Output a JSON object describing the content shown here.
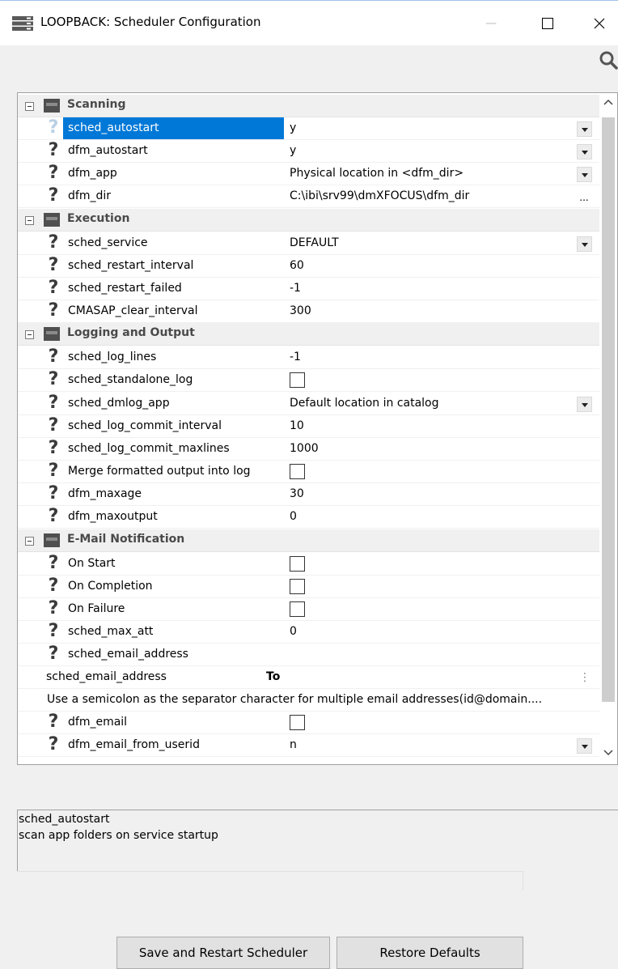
{
  "window": {
    "title": "LOOPBACK: Scheduler Configuration",
    "minimize_glyph": "—",
    "maximize_glyph": "☐",
    "close_glyph": "✕"
  },
  "grid": {
    "categories": {
      "scanning": "Scanning",
      "execution": "Execution",
      "logging": "Logging and Output",
      "email": "E-Mail Notification"
    },
    "properties": {
      "sched_autostart": {
        "name": "sched_autostart",
        "value": "y"
      },
      "dfm_autostart": {
        "name": "dfm_autostart",
        "value": "y"
      },
      "dfm_app": {
        "name": "dfm_app",
        "value": "Physical location in <dfm_dir>"
      },
      "dfm_dir": {
        "name": "dfm_dir",
        "value": "C:\\ibi\\srv99\\dmXFOCUS\\dfm_dir"
      },
      "sched_service": {
        "name": "sched_service",
        "value": "DEFAULT"
      },
      "sched_restart_interval": {
        "name": "sched_restart_interval",
        "value": "60"
      },
      "sched_restart_failed": {
        "name": "sched_restart_failed",
        "value": "-1"
      },
      "CMASAP_clear_interval": {
        "name": "CMASAP_clear_interval",
        "value": "300"
      },
      "sched_log_lines": {
        "name": "sched_log_lines",
        "value": "-1"
      },
      "sched_standalone_log": {
        "name": "sched_standalone_log"
      },
      "sched_dmlog_app": {
        "name": "sched_dmlog_app",
        "value": "Default location in catalog"
      },
      "sched_log_commit_interval": {
        "name": "sched_log_commit_interval",
        "value": "10"
      },
      "sched_log_commit_maxlines": {
        "name": "sched_log_commit_maxlines",
        "value": "1000"
      },
      "merge_output": {
        "name": "Merge formatted output into log"
      },
      "dfm_maxage": {
        "name": "dfm_maxage",
        "value": "30"
      },
      "dfm_maxoutput": {
        "name": "dfm_maxoutput",
        "value": "0"
      },
      "on_start": {
        "name": "On Start"
      },
      "on_completion": {
        "name": "On Completion"
      },
      "on_failure": {
        "name": "On Failure"
      },
      "sched_max_att": {
        "name": "sched_max_att",
        "value": "0"
      },
      "sched_email_address": {
        "name": "sched_email_address"
      },
      "dfm_email": {
        "name": "dfm_email"
      },
      "dfm_email_from_userid": {
        "name": "dfm_email_from_userid",
        "value": "n"
      }
    },
    "email_sub": {
      "name": "sched_email_address",
      "to_label": "To",
      "note": "Use a semicolon as the separator character for multiple email addresses(id@domain...."
    },
    "selected": "sched_autostart",
    "dfm_dir_browse": "..."
  },
  "description": {
    "title": "sched_autostart",
    "text": "scan app folders on service startup"
  },
  "buttons": {
    "save": "Save and Restart Scheduler",
    "restore": "Restore Defaults"
  },
  "icons": {
    "app": "server-icon",
    "search": "search-icon",
    "category": "category-icon",
    "property": "question-mark-icon"
  },
  "colors": {
    "selection": "#0078d7",
    "category_bg": "#f0f0f0",
    "window_bg": "#f0f0f0"
  }
}
